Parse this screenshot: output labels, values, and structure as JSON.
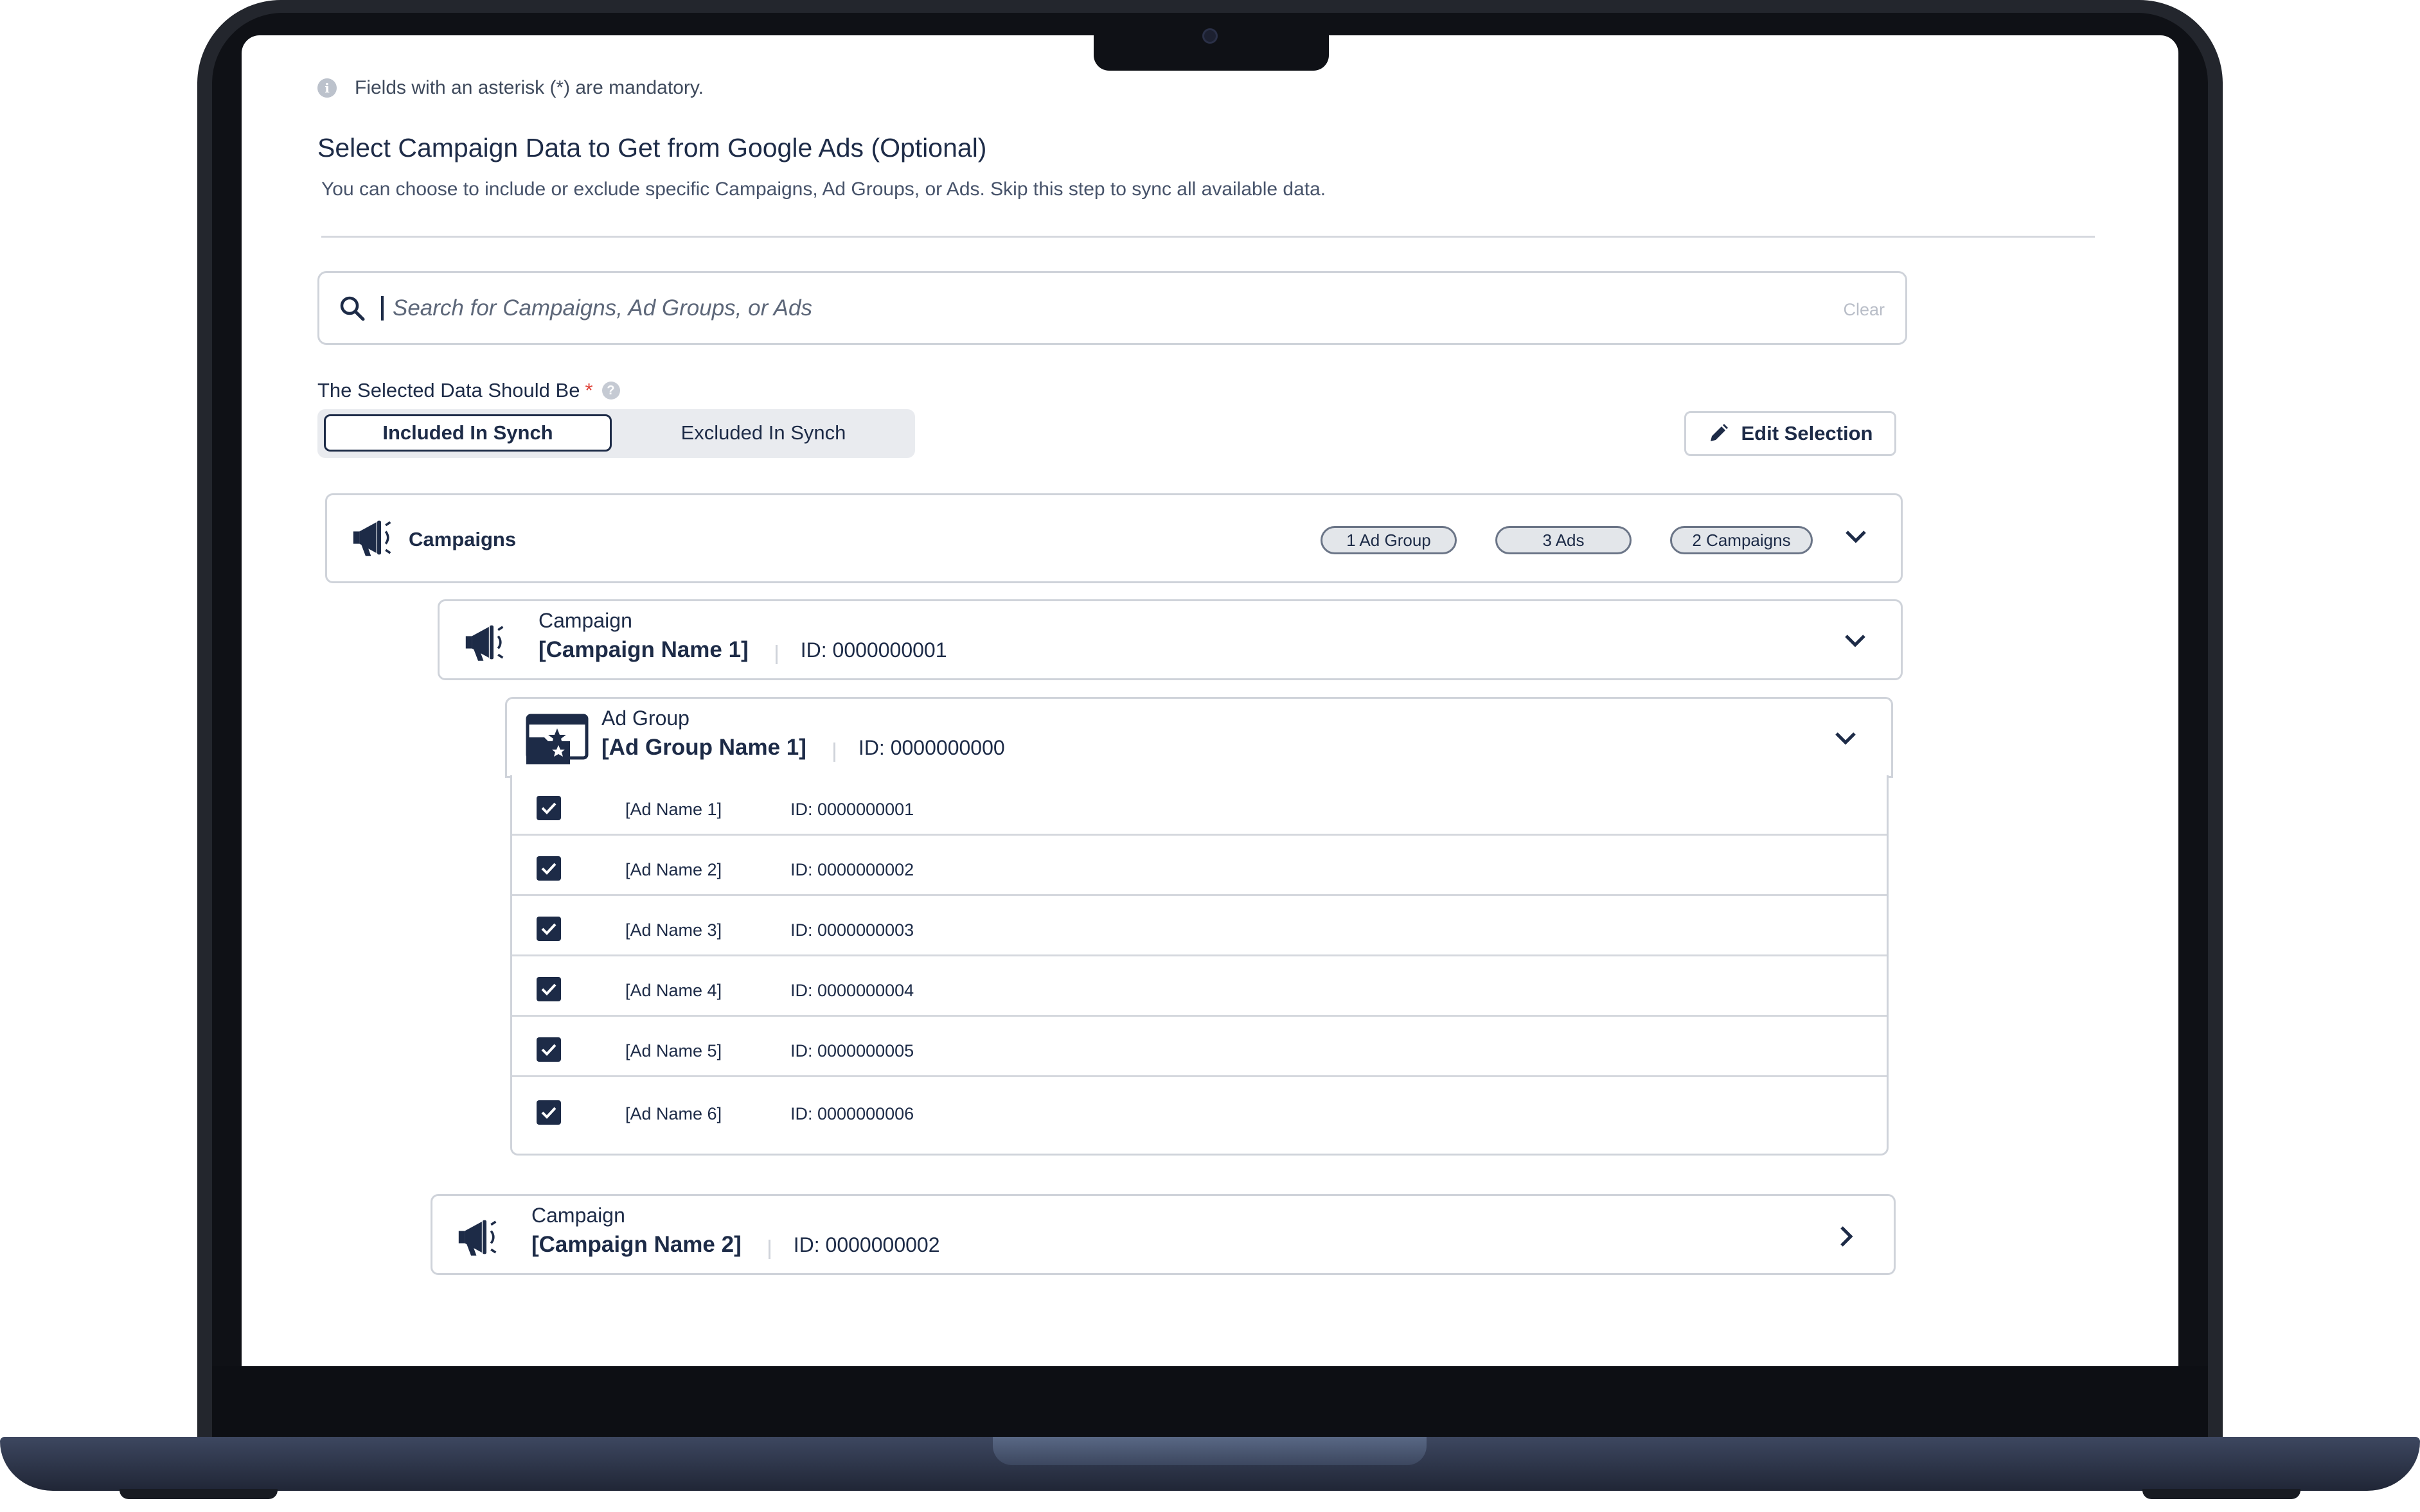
{
  "note": {
    "text": "Fields with an asterisk (*) are mandatory."
  },
  "section": {
    "title": "Select Campaign Data to Get from Google Ads (Optional)",
    "subtitle": "You can choose to include or exclude specific Campaigns, Ad Groups, or Ads. Skip this step to sync all available data."
  },
  "search": {
    "placeholder": "Search for Campaigns, Ad Groups, or Ads",
    "clear_label": "Clear"
  },
  "selection": {
    "label": "The Selected Data Should Be",
    "asterisk": "*",
    "help": "?",
    "options": [
      "Included In Synch",
      "Excluded In Synch"
    ],
    "selected": "Included In Synch",
    "edit_label": "Edit Selection"
  },
  "campaigns_panel": {
    "title": "Campaigns",
    "badges": [
      "1 Ad Group",
      "3 Ads",
      "2 Campaigns"
    ]
  },
  "campaigns": [
    {
      "type": "Campaign",
      "name": "[Campaign Name 1]",
      "id": "ID: 0000000001",
      "expanded": true
    },
    {
      "type": "Campaign",
      "name": "[Campaign Name 2]",
      "id": "ID: 0000000002",
      "expanded": false
    }
  ],
  "ad_group": {
    "type": "Ad Group",
    "name": "[Ad Group Name 1]",
    "id": "ID: 0000000000"
  },
  "ads": [
    {
      "name": "[Ad Name 1]",
      "id": "ID: 0000000001",
      "checked": true
    },
    {
      "name": "[Ad Name 2]",
      "id": "ID: 0000000002",
      "checked": true
    },
    {
      "name": "[Ad Name 3]",
      "id": "ID: 0000000003",
      "checked": true
    },
    {
      "name": "[Ad Name 4]",
      "id": "ID: 0000000004",
      "checked": true
    },
    {
      "name": "[Ad Name 5]",
      "id": "ID: 0000000005",
      "checked": true
    },
    {
      "name": "[Ad Name 6]",
      "id": "ID: 0000000006",
      "checked": true
    }
  ],
  "icons": {
    "info": "info-icon",
    "search": "search-icon",
    "help": "question-icon",
    "edit": "pencil-icon",
    "campaign": "megaphone-icon",
    "ad_group": "browser-folder-icon",
    "expand": "chevron-down-icon",
    "collapse": "chevron-right-icon",
    "check": "checkmark-icon"
  },
  "colors": {
    "primary": "#1d2b47",
    "border": "#cfd3da",
    "asterisk": "#e0453c",
    "frame": "#23262d"
  }
}
